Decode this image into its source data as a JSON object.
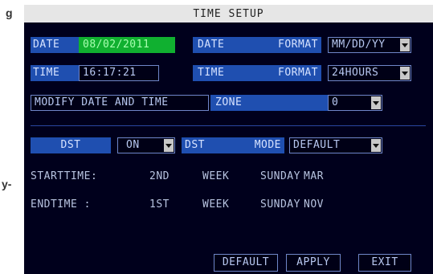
{
  "side_fragments": {
    "top": "g",
    "bottom": "y-"
  },
  "window": {
    "title": "TIME SETUP"
  },
  "date": {
    "label": "DATE",
    "value": "08/02/2011"
  },
  "date_format": {
    "label_left": "DATE",
    "label_right": "FORMAT",
    "value": "MM/DD/YY"
  },
  "time": {
    "label": "TIME",
    "value": "16:17:21"
  },
  "time_format": {
    "label_left": "TIME",
    "label_right": "FORMAT",
    "value": "24HOURS"
  },
  "modify": {
    "label": "MODIFY DATE AND TIME"
  },
  "zone": {
    "label": "ZONE",
    "value": "0"
  },
  "dst": {
    "label": "DST",
    "value": "ON"
  },
  "dst_mode": {
    "label_left": "DST",
    "label_right": "MODE",
    "value": "DEFAULT"
  },
  "start": {
    "label": "STARTTIME:",
    "nth": "2ND",
    "week": "WEEK",
    "day": "SUNDAY",
    "month": "MAR"
  },
  "end": {
    "label": "ENDTIME  :",
    "nth": "1ST",
    "week": "WEEK",
    "day": "SUNDAY",
    "month": "NOV"
  },
  "buttons": {
    "default": "DEFAULT",
    "apply": "APPLY",
    "exit": "EXIT"
  }
}
